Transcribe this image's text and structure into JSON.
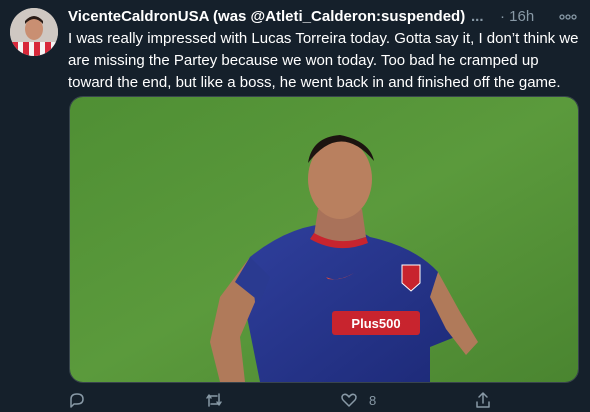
{
  "tweet": {
    "display_name": "VicenteCaldronUSA (was @Atleti_Calderon:suspended)",
    "truncation": "...",
    "time_separator_and_age": "· 16h",
    "text": "I was really impressed with Lucas Torreira today. Gotta say it, I don’t think we are missing the Partey because we won today. Too bad he cramped up toward the end, but like a boss, he went back in and finished off the game.",
    "media": {
      "description_icon": "photo-of-soccer-player",
      "jersey_sponsor": "Plus500"
    },
    "actions": {
      "reply_icon": "reply-icon",
      "retweet_icon": "retweet-icon",
      "like_icon": "heart-icon",
      "like_count": "8",
      "share_icon": "share-icon"
    }
  },
  "colors": {
    "background": "#15202b",
    "secondary_text": "#8899a6",
    "primary_text": "#ffffff",
    "border": "#38444d"
  }
}
